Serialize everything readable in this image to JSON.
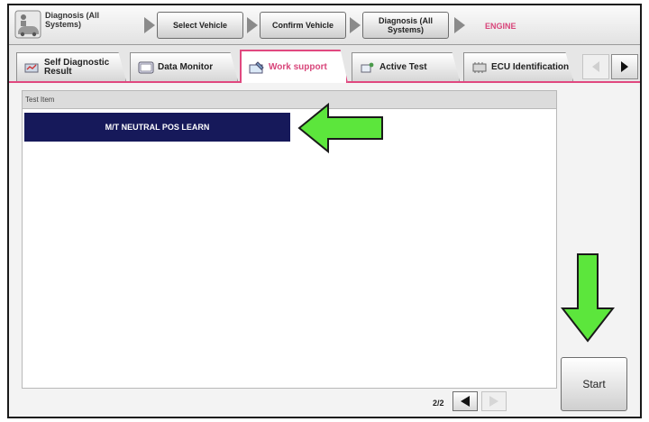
{
  "breadcrumb": {
    "home_label": "Diagnosis (All Systems)",
    "steps": [
      "Select Vehicle",
      "Confirm Vehicle",
      "Diagnosis (All Systems)"
    ],
    "current": "ENGINE"
  },
  "tabs": [
    {
      "label": "Self Diagnostic Result",
      "icon": "self-diagnostic-icon"
    },
    {
      "label": "Data Monitor",
      "icon": "data-monitor-icon"
    },
    {
      "label": "Work support",
      "icon": "work-support-icon",
      "active": true
    },
    {
      "label": "Active Test",
      "icon": "active-test-icon"
    },
    {
      "label": "ECU Identification",
      "icon": "ecu-identification-icon"
    }
  ],
  "list": {
    "header": "Test Item",
    "items": [
      "M/T NEUTRAL POS LEARN"
    ]
  },
  "pager": {
    "text": "2/2"
  },
  "start_label": "Start",
  "colors": {
    "accent": "#e0487f",
    "selected_row": "#16195a",
    "annotation_arrow": "#5ce63c"
  }
}
